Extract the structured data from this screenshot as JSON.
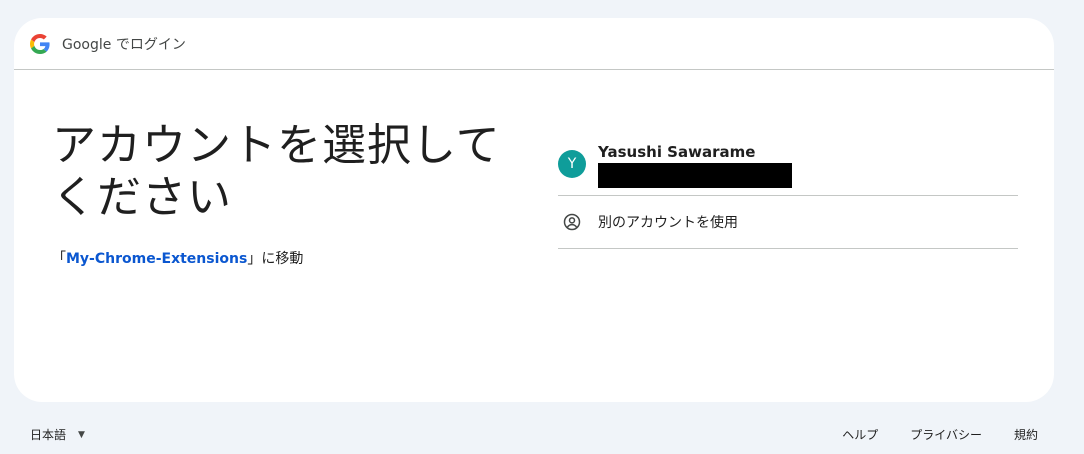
{
  "header": {
    "title": "Google でログイン",
    "logo_icon": "google-g-icon"
  },
  "main": {
    "headline_line1": "アカウントを選択して",
    "headline_line2": "ください",
    "continue_prefix": "「",
    "app_name": "My-Chrome-Extensions",
    "continue_suffix": "」に移動"
  },
  "accounts": [
    {
      "initial": "Y",
      "name": "Yasushi Sawarame",
      "avatar_color": "#0f9d9a"
    }
  ],
  "other_account": {
    "label": "別のアカウントを使用",
    "icon": "person-circle-icon"
  },
  "footer": {
    "language": "日本語",
    "links": {
      "help": "ヘルプ",
      "privacy": "プライバシー",
      "terms": "規約"
    }
  },
  "colors": {
    "link": "#0b57d0",
    "background": "#f0f4f9",
    "card": "#ffffff"
  }
}
